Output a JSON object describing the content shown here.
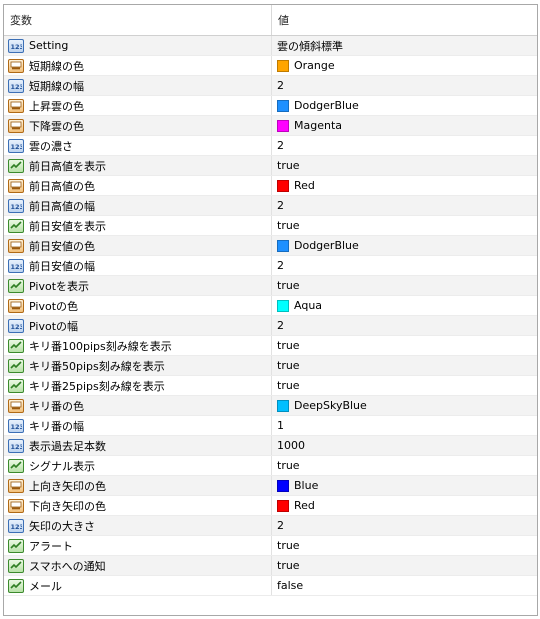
{
  "header": {
    "name_label": "変数",
    "value_label": "値"
  },
  "rows": [
    {
      "icon": "num-icon",
      "name": "Setting",
      "value": "雲の傾斜標準"
    },
    {
      "icon": "color-icon",
      "name": "短期線の色",
      "value": "Orange",
      "swatch": "#FFA500"
    },
    {
      "icon": "num-icon",
      "name": "短期線の幅",
      "value": "2"
    },
    {
      "icon": "color-icon",
      "name": "上昇雲の色",
      "value": "DodgerBlue",
      "swatch": "#1E90FF"
    },
    {
      "icon": "color-icon",
      "name": "下降雲の色",
      "value": "Magenta",
      "swatch": "#FF00FF"
    },
    {
      "icon": "num-icon",
      "name": "雲の濃さ",
      "value": "2"
    },
    {
      "icon": "bool-icon",
      "name": "前日高値を表示",
      "value": "true"
    },
    {
      "icon": "color-icon",
      "name": "前日高値の色",
      "value": "Red",
      "swatch": "#FF0000"
    },
    {
      "icon": "num-icon",
      "name": "前日高値の幅",
      "value": "2"
    },
    {
      "icon": "bool-icon",
      "name": "前日安値を表示",
      "value": "true"
    },
    {
      "icon": "color-icon",
      "name": "前日安値の色",
      "value": "DodgerBlue",
      "swatch": "#1E90FF"
    },
    {
      "icon": "num-icon",
      "name": "前日安値の幅",
      "value": "2"
    },
    {
      "icon": "bool-icon",
      "name": "Pivotを表示",
      "value": "true"
    },
    {
      "icon": "color-icon",
      "name": "Pivotの色",
      "value": "Aqua",
      "swatch": "#00FFFF"
    },
    {
      "icon": "num-icon",
      "name": "Pivotの幅",
      "value": "2"
    },
    {
      "icon": "bool-icon",
      "name": "キリ番100pips刻み線を表示",
      "value": "true"
    },
    {
      "icon": "bool-icon",
      "name": "キリ番50pips刻み線を表示",
      "value": "true"
    },
    {
      "icon": "bool-icon",
      "name": "キリ番25pips刻み線を表示",
      "value": "true"
    },
    {
      "icon": "color-icon",
      "name": "キリ番の色",
      "value": "DeepSkyBlue",
      "swatch": "#00BFFF"
    },
    {
      "icon": "num-icon",
      "name": "キリ番の幅",
      "value": "1"
    },
    {
      "icon": "num-icon",
      "name": "表示過去足本数",
      "value": "1000"
    },
    {
      "icon": "bool-icon",
      "name": "シグナル表示",
      "value": "true"
    },
    {
      "icon": "color-icon",
      "name": "上向き矢印の色",
      "value": "Blue",
      "swatch": "#0000FF"
    },
    {
      "icon": "color-icon",
      "name": "下向き矢印の色",
      "value": "Red",
      "swatch": "#FF0000"
    },
    {
      "icon": "num-icon",
      "name": "矢印の大きさ",
      "value": "2"
    },
    {
      "icon": "bool-icon",
      "name": "アラート",
      "value": "true"
    },
    {
      "icon": "bool-icon",
      "name": "スマホへの通知",
      "value": "true"
    },
    {
      "icon": "bool-icon",
      "name": "メール",
      "value": "false"
    }
  ]
}
